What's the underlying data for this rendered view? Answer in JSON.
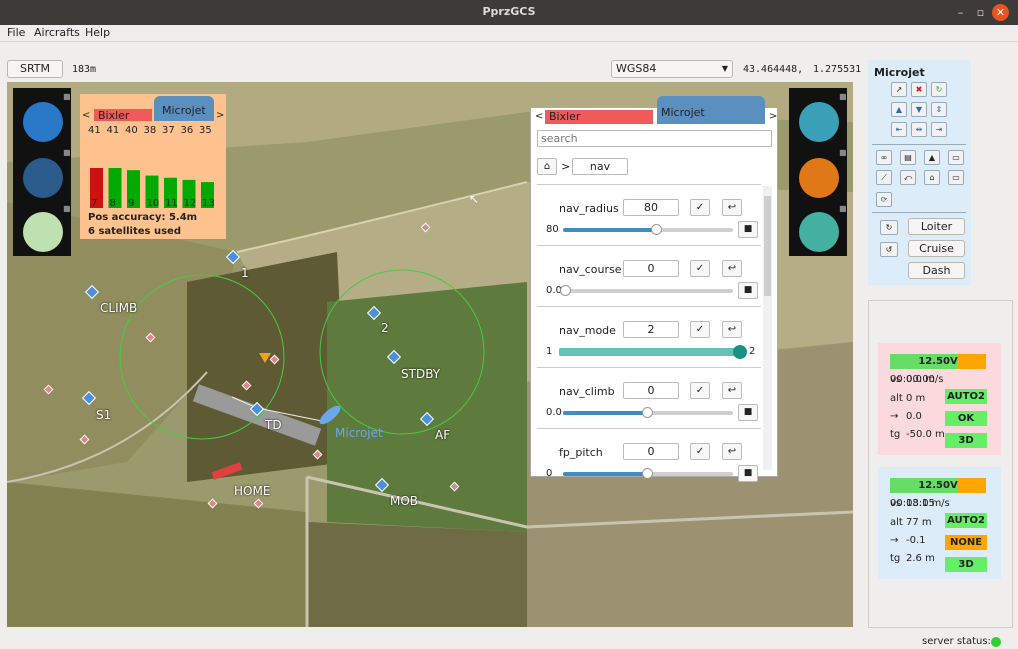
{
  "window": {
    "title": "PprzGCS"
  },
  "menu": [
    "File",
    "Aircrafts",
    "Help"
  ],
  "toolbar": {
    "srtm_label": "SRTM",
    "altitude": "183m",
    "projection": "WGS84",
    "lat": "43.464448,",
    "lon": "1.275531"
  },
  "gps": {
    "tabs": [
      "Bixler",
      "Microjet"
    ],
    "top_values": [
      "41",
      "41",
      "40",
      "38",
      "37",
      "36",
      "35"
    ],
    "bottom_ids": [
      "7",
      "8",
      "9",
      "10",
      "11",
      "12",
      "13"
    ],
    "bars": [
      {
        "value": 37,
        "status": "bad"
      },
      {
        "value": 37,
        "status": "good"
      },
      {
        "value": 35,
        "status": "good"
      },
      {
        "value": 30,
        "status": "good"
      },
      {
        "value": 28,
        "status": "good"
      },
      {
        "value": 26,
        "status": "good"
      },
      {
        "value": 24,
        "status": "good"
      }
    ],
    "accuracy": "Pos accuracy: 5.4m",
    "satellites": "6 satellites used",
    "colors": {
      "good": "#00aa00",
      "bad": "#cc1111",
      "background": "#fec28f"
    }
  },
  "map_labels": {
    "wp1": "1",
    "wp2": "2",
    "climb": "CLIMB",
    "s1": "S1",
    "stdby": "STDBY",
    "td": "TD",
    "af": "AF",
    "home": "HOME",
    "mob": "MOB",
    "aircraft": "Microjet"
  },
  "left_tools": [
    "layers-icon",
    "satellite-icon",
    "flightplan-icon"
  ],
  "right_tools": [
    "signal-icon",
    "attitude-icon",
    "settings-sliders-icon"
  ],
  "settings": {
    "tabs": [
      "Bixler",
      "Microjet"
    ],
    "search_placeholder": "search",
    "path": "nav",
    "params": [
      {
        "name": "nav_radius",
        "value": "80",
        "slider_left": "80",
        "slider_right": "",
        "fraction": 0.55,
        "locked": true
      },
      {
        "name": "nav_course",
        "value": "0",
        "slider_left": "0.00",
        "slider_right": "",
        "fraction": 0.02,
        "locked": true
      },
      {
        "name": "nav_mode",
        "value": "2",
        "slider_left": "1",
        "slider_right": "2",
        "fraction": 1.0,
        "locked": false
      },
      {
        "name": "nav_climb",
        "value": "0",
        "slider_left": "0.0",
        "slider_right": "",
        "fraction": 0.5,
        "locked": true
      },
      {
        "name": "fp_pitch",
        "value": "0",
        "slider_left": "0",
        "slider_right": "",
        "fraction": 0.5,
        "locked": true
      }
    ]
  },
  "commands": {
    "title": "Microjet",
    "loiter": "Loiter",
    "cruise": "Cruise",
    "dash": "Dash"
  },
  "strips": [
    {
      "battery": "12.50V",
      "time": "00:00:00",
      "vs": "vs",
      "vs_value": "0.0 m/s",
      "alt": "alt",
      "alt_value": "0 m",
      "arrow": "→",
      "arrow_value": "0.0",
      "tg": "tg",
      "tg_value": "-50.0 m",
      "mode": "AUTO2",
      "link": "OK",
      "gps": "3D",
      "bg": "#fadadd"
    },
    {
      "battery": "12.50V",
      "time": "00:08:05",
      "vs": "vs",
      "vs_value": "13.1 m/s",
      "alt": "alt",
      "alt_value": "77 m",
      "arrow": "→",
      "arrow_value": "-0.1",
      "tg": "tg",
      "tg_value": "2.6 m",
      "mode": "AUTO2",
      "link": "NONE",
      "gps": "3D",
      "bg": "#dcecf8"
    }
  ],
  "status": {
    "label": "server status:",
    "color": "#33cc33"
  }
}
